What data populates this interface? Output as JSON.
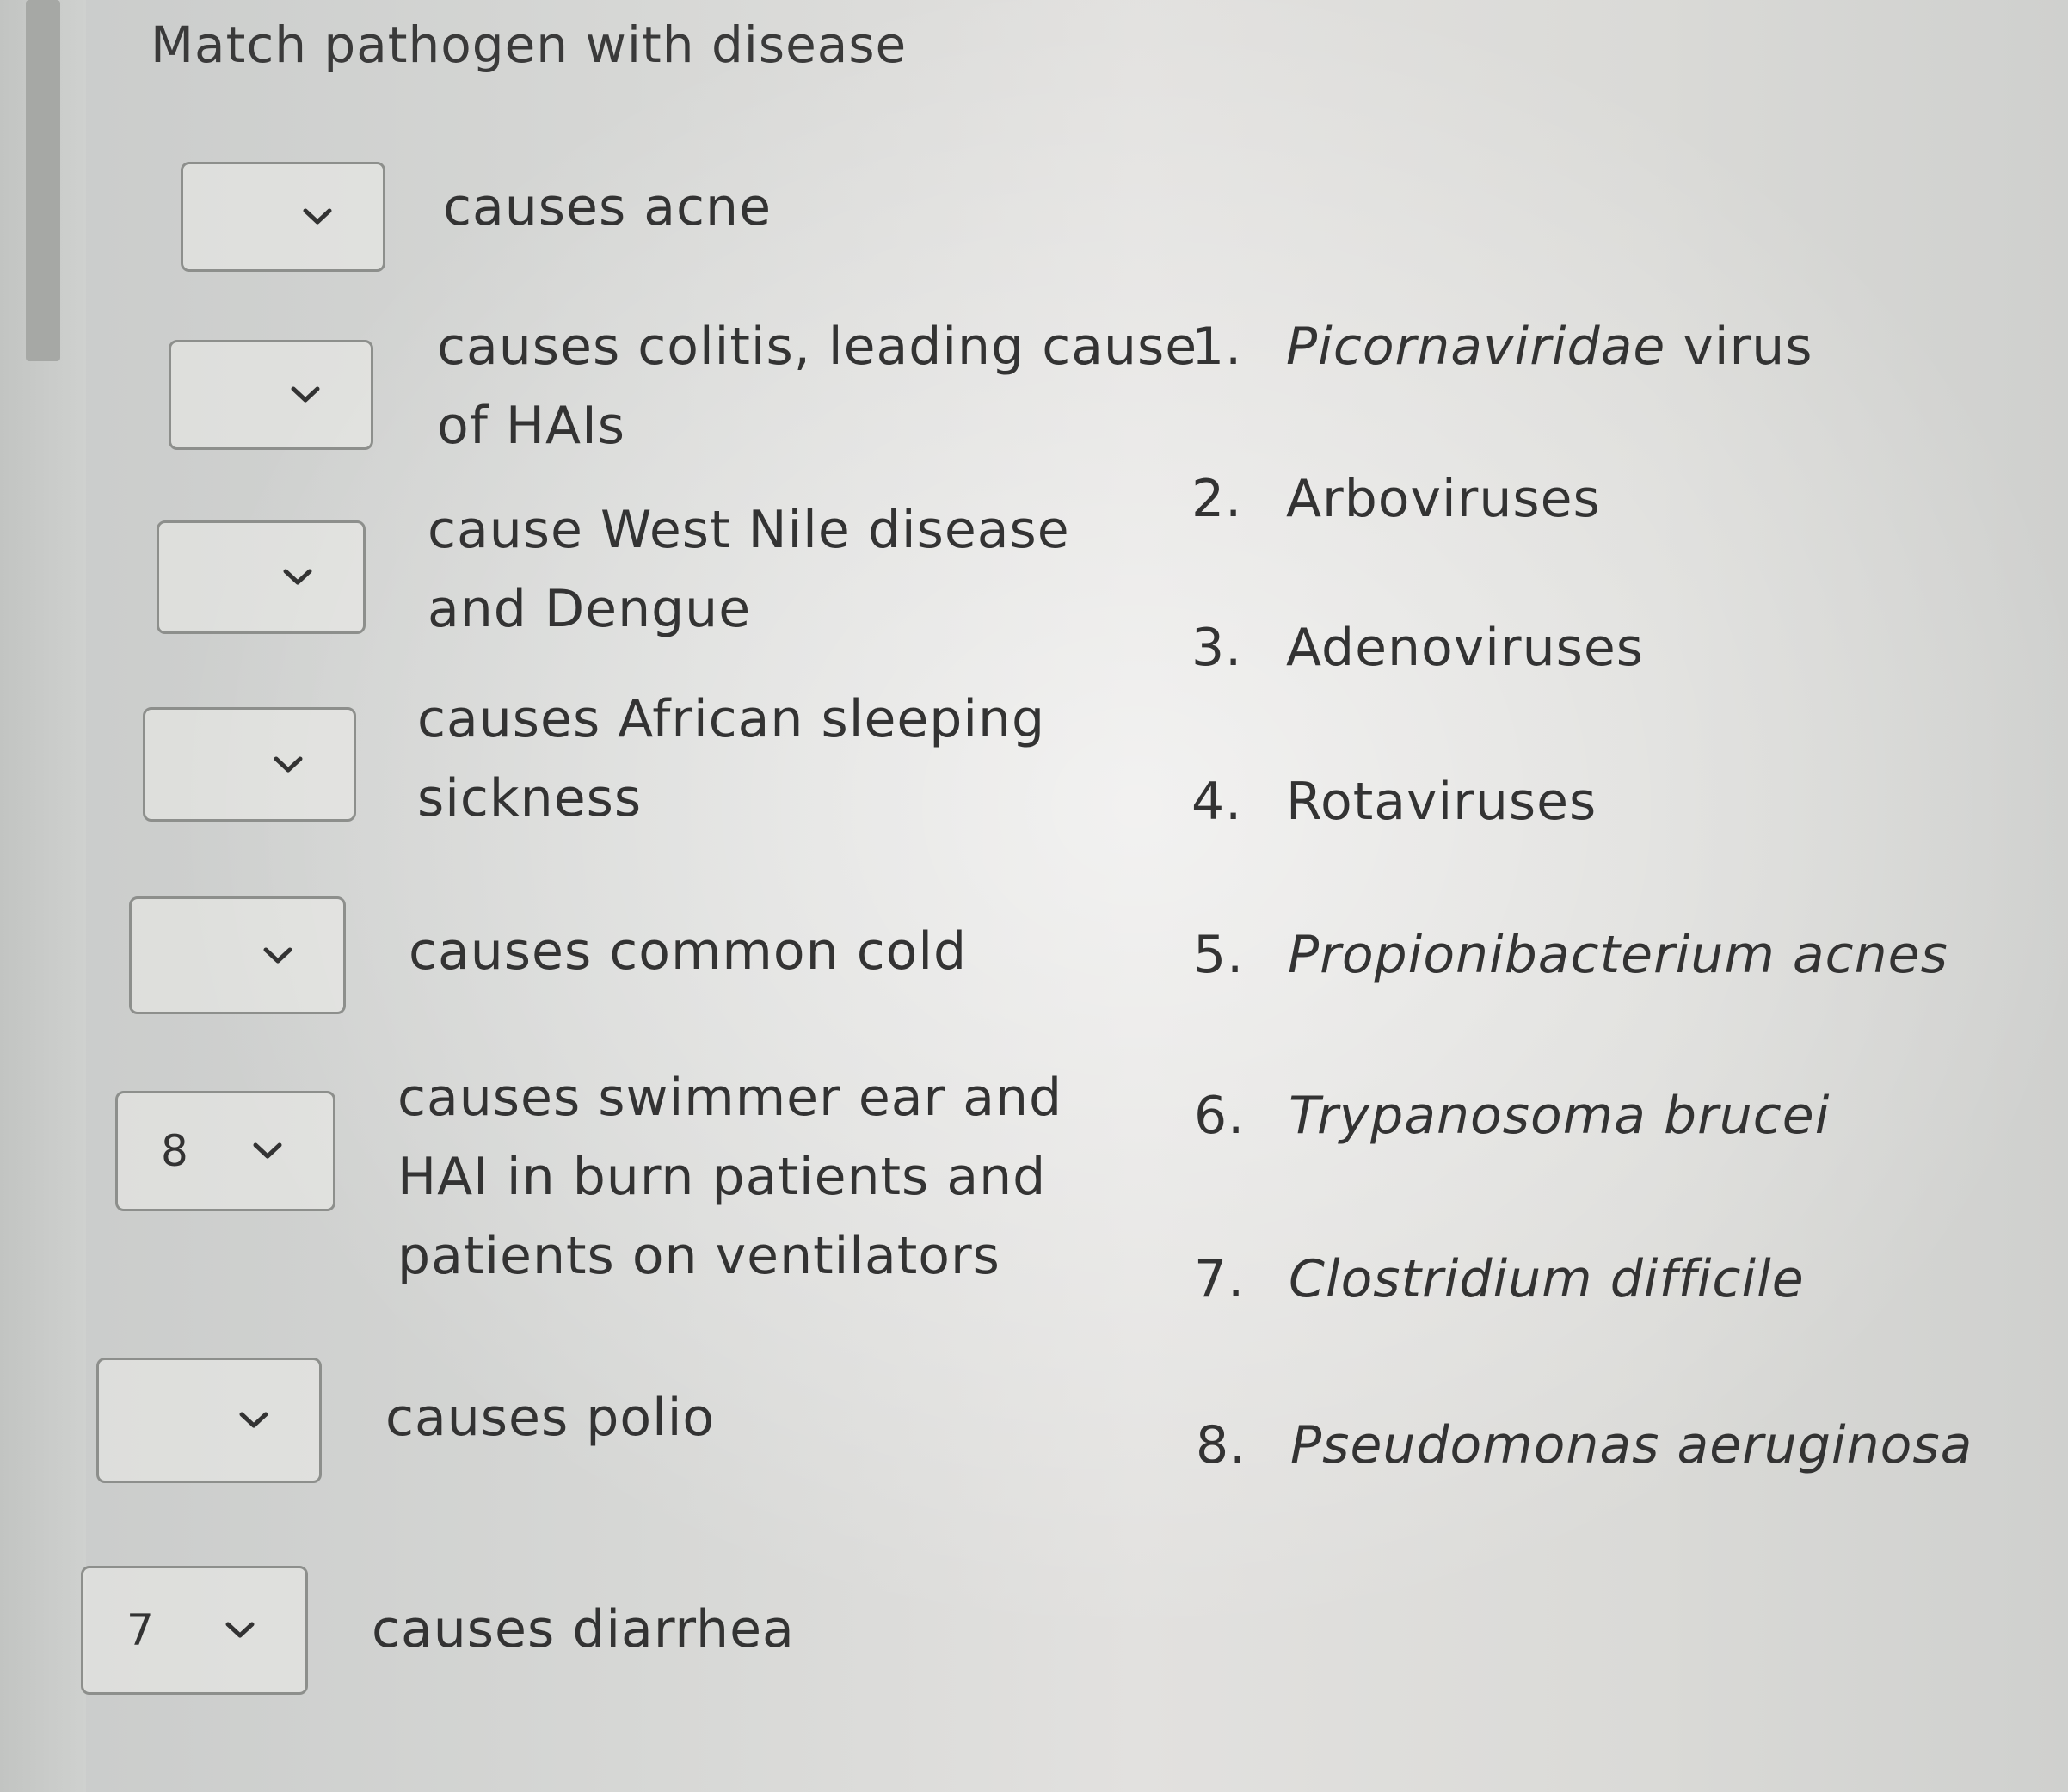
{
  "question": {
    "title": "Match pathogen with disease"
  },
  "rows": [
    {
      "value": "",
      "clue": [
        "causes acne"
      ]
    },
    {
      "value": "",
      "clue": [
        "causes colitis, leading cause",
        "of HAIs"
      ]
    },
    {
      "value": "",
      "clue": [
        "cause West Nile disease",
        "and Dengue"
      ]
    },
    {
      "value": "",
      "clue": [
        "causes African sleeping",
        "sickness"
      ]
    },
    {
      "value": "",
      "clue": [
        "causes common cold"
      ]
    },
    {
      "value": "8",
      "clue": [
        "causes swimmer ear and",
        "HAI in burn patients and",
        "patients on ventilators"
      ]
    },
    {
      "value": "",
      "clue": [
        "causes polio"
      ]
    },
    {
      "value": "7",
      "clue": [
        "causes diarrhea"
      ]
    }
  ],
  "answers": [
    {
      "num": "1.",
      "italic_part": "Picornaviridae",
      "plain_part": " virus"
    },
    {
      "num": "2.",
      "italic_part": "",
      "plain_part": "Arboviruses"
    },
    {
      "num": "3.",
      "italic_part": "",
      "plain_part": "Adenoviruses"
    },
    {
      "num": "4.",
      "italic_part": "",
      "plain_part": "Rotaviruses"
    },
    {
      "num": "5.",
      "italic_part": "Propionibacterium acnes",
      "plain_part": ""
    },
    {
      "num": "6.",
      "italic_part": "Trypanosoma brucei",
      "plain_part": ""
    },
    {
      "num": "7.",
      "italic_part": "Clostridium difficile",
      "plain_part": ""
    },
    {
      "num": "8.",
      "italic_part": "Pseudomonas aeruginosa",
      "plain_part": ""
    }
  ],
  "icons": {
    "dropdown_chevron": "chevron-down-icon"
  }
}
